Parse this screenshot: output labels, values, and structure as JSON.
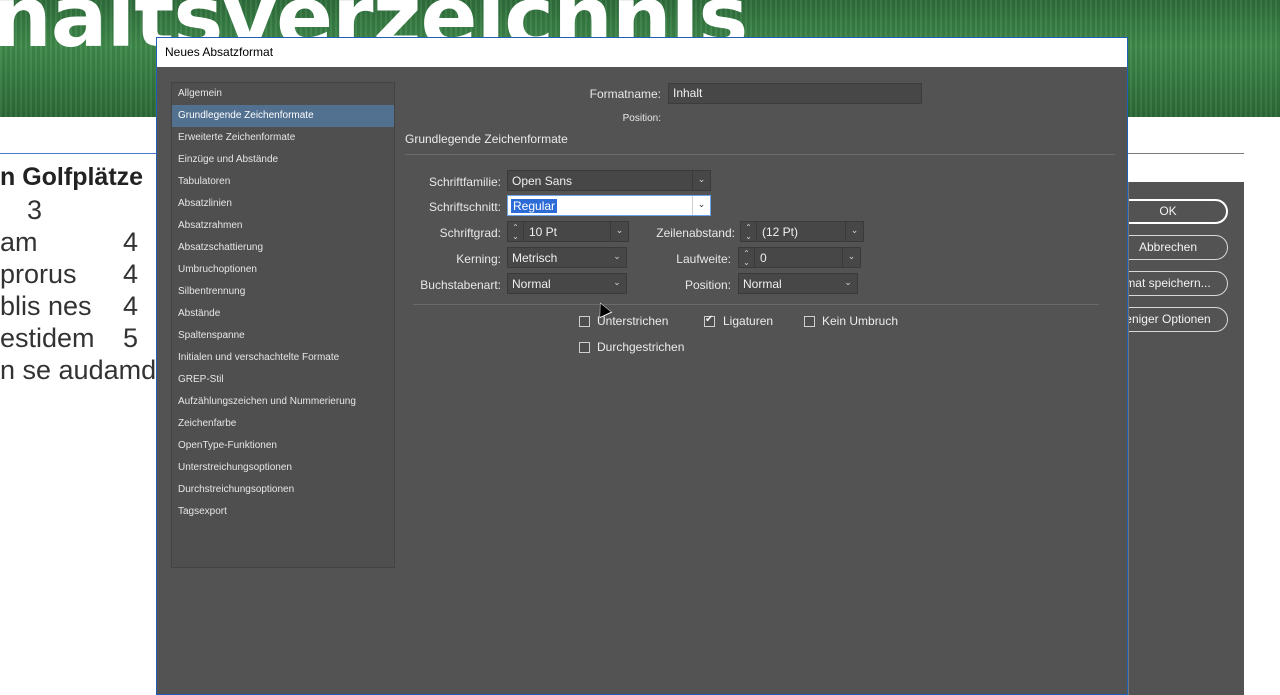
{
  "document": {
    "header_title": "naltsverzeichnis",
    "lines": [
      {
        "text": "n Golfplätze",
        "num": ""
      },
      {
        "text": "",
        "num": "3"
      },
      {
        "text": "am",
        "num": "4"
      },
      {
        "text": "prorus",
        "num": "4"
      },
      {
        "text": "blis nes",
        "num": "4"
      },
      {
        "text": "estidem",
        "num": "5"
      },
      {
        "text": "n se audamd",
        "num": ""
      }
    ]
  },
  "dialog": {
    "title": "Neues Absatzformat",
    "categories": [
      "Allgemein",
      "Grundlegende Zeichenformate",
      "Erweiterte Zeichenformate",
      "Einzüge und Abstände",
      "Tabulatoren",
      "Absatzlinien",
      "Absatzrahmen",
      "Absatzschattierung",
      "Umbruchoptionen",
      "Silbentrennung",
      "Abstände",
      "Spaltenspanne",
      "Initialen und verschachtelte Formate",
      "GREP-Stil",
      "Aufzählungszeichen und Nummerierung",
      "Zeichenfarbe",
      "OpenType-Funktionen",
      "Unterstreichungsoptionen",
      "Durchstreichungsoptionen",
      "Tagsexport"
    ],
    "selected_category": "Grundlegende Zeichenformate",
    "format_name_label": "Formatname:",
    "format_name_value": "Inhalt",
    "position_label": "Position:",
    "section_heading": "Grundlegende Zeichenformate",
    "font_family_label": "Schriftfamilie:",
    "font_family_value": "Open Sans",
    "font_style_label": "Schriftschnitt:",
    "font_style_value": "Regular",
    "size_label": "Schriftgrad:",
    "size_value": "10 Pt",
    "leading_label": "Zeilenabstand:",
    "leading_value": "(12 Pt)",
    "kerning_label": "Kerning:",
    "kerning_value": "Metrisch",
    "tracking_label": "Laufweite:",
    "tracking_value": "0",
    "case_label": "Buchstabenart:",
    "case_value": "Normal",
    "position2_label": "Position:",
    "position2_value": "Normal",
    "underline_label": "Unterstrichen",
    "ligatures_label": "Ligaturen",
    "no_break_label": "Kein Umbruch",
    "strikethrough_label": "Durchgestrichen"
  },
  "side_panel": {
    "ok_label": "OK",
    "cancel_label": "Abbrechen",
    "save_label": "mat speichern...",
    "fewer_label": "eniger Optionen"
  },
  "colors": {
    "dialog_bg": "#535353",
    "selected_row": "#52708f",
    "focus_highlight": "#2d6cd6"
  }
}
